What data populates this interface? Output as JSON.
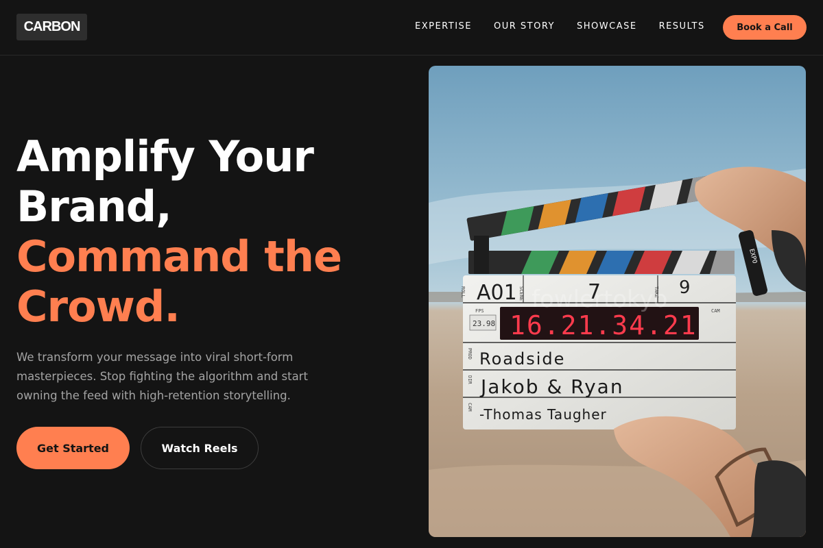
{
  "brand": {
    "logo_text": "CARBON"
  },
  "nav": {
    "items": [
      {
        "label": "EXPERTISE"
      },
      {
        "label": "OUR STORY"
      },
      {
        "label": "SHOWCASE"
      },
      {
        "label": "RESULTS"
      }
    ],
    "cta_label": "Book a Call"
  },
  "hero": {
    "title_line1": "Amplify Your",
    "title_line2": "Brand,",
    "title_line3": "Command the",
    "title_line4": "Crowd.",
    "subtitle": "We transform your message into viral short-form masterpieces. Stop fighting the algorithm and start owning the feed with high-retention storytelling.",
    "primary_button": "Get Started",
    "secondary_button": "Watch Reels"
  },
  "image": {
    "slate": {
      "roll_label": "ROLL",
      "scene_label": "SCENE",
      "take_label": "TAKE",
      "roll_value": "A01",
      "scene_value": "7",
      "take_value": "9",
      "fps_label": "FPS",
      "fps_value": "23.98",
      "timecode": "16.21.34.21",
      "cam_label": "CAM",
      "prod_label": "PROD",
      "dir_label": "DIR",
      "cam2_label": "CAM",
      "production": "Roadside",
      "director": "Jakob & Ryan",
      "camera": "-Thomas Taugher",
      "watermark": "fowlertokyo",
      "marker_brand": "EXPO"
    }
  },
  "colors": {
    "accent": "#ff7f50",
    "background": "#141414",
    "muted_text": "#a4a4a4"
  }
}
